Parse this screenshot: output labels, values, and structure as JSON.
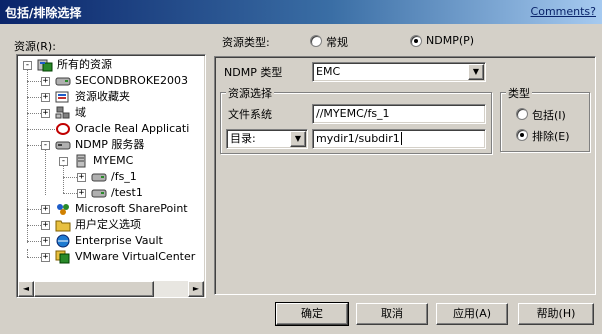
{
  "window": {
    "title": "包括/排除选择",
    "comments_link": "Comments?"
  },
  "resources_label": "资源(R):",
  "tree": {
    "items": [
      {
        "label": "所有的资源",
        "icon": "all-resources-icon",
        "expander": "-"
      },
      {
        "label": "SECONDBROKE2003",
        "icon": "server-drive-icon",
        "expander": "+"
      },
      {
        "label": "资源收藏夹",
        "icon": "favorites-icon",
        "expander": "+"
      },
      {
        "label": "域",
        "icon": "domain-icon",
        "expander": "+"
      },
      {
        "label": "Oracle Real Applicati",
        "icon": "oracle-icon",
        "expander": ""
      },
      {
        "label": "NDMP 服务器",
        "icon": "ndmp-server-icon",
        "expander": "-"
      },
      {
        "label": "MYEMC",
        "icon": "emc-server-icon",
        "expander": "-"
      },
      {
        "label": "/fs_1",
        "icon": "volume-icon",
        "expander": "+"
      },
      {
        "label": "/test1",
        "icon": "volume-icon",
        "expander": "+"
      },
      {
        "label": "Microsoft SharePoint",
        "icon": "sharepoint-icon",
        "expander": "+"
      },
      {
        "label": "用户定义选项",
        "icon": "user-defined-icon",
        "expander": "+"
      },
      {
        "label": "Enterprise Vault",
        "icon": "enterprise-vault-icon",
        "expander": "+"
      },
      {
        "label": "VMware VirtualCenter",
        "icon": "vmware-icon",
        "expander": "+"
      }
    ],
    "scroll_left_symbol": "◄",
    "scroll_right_symbol": "►"
  },
  "resource_type": {
    "label": "资源类型:",
    "options": [
      {
        "label": "常规",
        "selected": false
      },
      {
        "label": "NDMP(P)",
        "selected": true
      }
    ]
  },
  "ndmp_type": {
    "label": "NDMP 类型",
    "value": "EMC"
  },
  "resource_selection": {
    "group_title": "资源选择",
    "filesystem_label": "文件系统",
    "filesystem_value": "//MYEMC/fs_1",
    "dir_select_value": "目录:",
    "dir_value": "mydir1/subdir1"
  },
  "type_group": {
    "title": "类型",
    "options": [
      {
        "label": "包括(I)",
        "selected": false
      },
      {
        "label": "排除(E)",
        "selected": true
      }
    ]
  },
  "buttons": {
    "ok": "确定",
    "cancel": "取消",
    "apply": "应用(A)",
    "help": "帮助(H)"
  },
  "dropdown_symbol": "▼"
}
